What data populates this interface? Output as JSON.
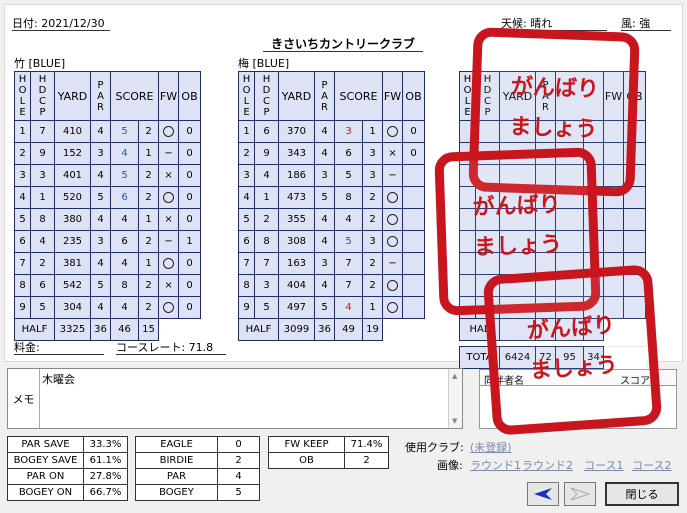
{
  "header": {
    "date": "日付: 2021/12/30",
    "weather": "天候: 晴れ",
    "wind": "風: 強",
    "course_title": "きさいちカントリークラブ"
  },
  "tables": [
    {
      "name": "竹 [BLUE]",
      "headers": [
        "HOLE",
        "HDCP",
        "YARD",
        "PAR",
        "SCORE",
        "FW",
        "OB"
      ],
      "rows": [
        {
          "hole": "1",
          "hdcp": "7",
          "yard": "410",
          "par": "4",
          "score": "5",
          "putt": "2",
          "fw": "○",
          "ob": "0",
          "sc": "blue"
        },
        {
          "hole": "2",
          "hdcp": "9",
          "yard": "152",
          "par": "3",
          "score": "4",
          "putt": "1",
          "fw": "−",
          "ob": "0",
          "sc": "blue"
        },
        {
          "hole": "3",
          "hdcp": "3",
          "yard": "401",
          "par": "4",
          "score": "5",
          "putt": "2",
          "fw": "×",
          "ob": "0",
          "sc": "blue"
        },
        {
          "hole": "4",
          "hdcp": "1",
          "yard": "520",
          "par": "5",
          "score": "6",
          "putt": "2",
          "fw": "○",
          "ob": "0",
          "sc": "blue"
        },
        {
          "hole": "5",
          "hdcp": "8",
          "yard": "380",
          "par": "4",
          "score": "4",
          "putt": "1",
          "fw": "×",
          "ob": "0",
          "sc": ""
        },
        {
          "hole": "6",
          "hdcp": "4",
          "yard": "235",
          "par": "3",
          "score": "6",
          "putt": "2",
          "fw": "−",
          "ob": "1",
          "sc": "bold"
        },
        {
          "hole": "7",
          "hdcp": "2",
          "yard": "381",
          "par": "4",
          "score": "4",
          "putt": "1",
          "fw": "○",
          "ob": "0",
          "sc": ""
        },
        {
          "hole": "8",
          "hdcp": "6",
          "yard": "542",
          "par": "5",
          "score": "8",
          "putt": "2",
          "fw": "×",
          "ob": "0",
          "sc": "bold"
        },
        {
          "hole": "9",
          "hdcp": "5",
          "yard": "304",
          "par": "4",
          "score": "4",
          "putt": "2",
          "fw": "○",
          "ob": "0",
          "sc": ""
        }
      ],
      "half": {
        "label": "HALF",
        "yard": "3325",
        "par": "36",
        "score": "46",
        "putt": "15"
      }
    },
    {
      "name": "梅 [BLUE]",
      "headers": [
        "HOLE",
        "HDCP",
        "YARD",
        "PAR",
        "SCORE",
        "FW",
        "OB"
      ],
      "rows": [
        {
          "hole": "1",
          "hdcp": "6",
          "yard": "370",
          "par": "4",
          "score": "3",
          "putt": "1",
          "fw": "○",
          "ob": "0",
          "sc": "red"
        },
        {
          "hole": "2",
          "hdcp": "9",
          "yard": "343",
          "par": "4",
          "score": "6",
          "putt": "3",
          "fw": "×",
          "ob": "0",
          "sc": "bold"
        },
        {
          "hole": "3",
          "hdcp": "4",
          "yard": "186",
          "par": "3",
          "score": "5",
          "putt": "3",
          "fw": "−",
          "ob": "",
          "sc": "bold"
        },
        {
          "hole": "4",
          "hdcp": "1",
          "yard": "473",
          "par": "5",
          "score": "8",
          "putt": "2",
          "fw": "○",
          "ob": "",
          "sc": "bold"
        },
        {
          "hole": "5",
          "hdcp": "2",
          "yard": "355",
          "par": "4",
          "score": "4",
          "putt": "2",
          "fw": "○",
          "ob": "",
          "sc": ""
        },
        {
          "hole": "6",
          "hdcp": "8",
          "yard": "308",
          "par": "4",
          "score": "5",
          "putt": "3",
          "fw": "○",
          "ob": "",
          "sc": "blue"
        },
        {
          "hole": "7",
          "hdcp": "7",
          "yard": "163",
          "par": "3",
          "score": "7",
          "putt": "2",
          "fw": "−",
          "ob": "",
          "sc": ""
        },
        {
          "hole": "8",
          "hdcp": "3",
          "yard": "404",
          "par": "4",
          "score": "7",
          "putt": "2",
          "fw": "○",
          "ob": "",
          "sc": "bold"
        },
        {
          "hole": "9",
          "hdcp": "5",
          "yard": "497",
          "par": "5",
          "score": "4",
          "putt": "1",
          "fw": "○",
          "ob": "",
          "sc": "red"
        }
      ],
      "half": {
        "label": "HALF",
        "yard": "3099",
        "par": "36",
        "score": "49",
        "putt": "19"
      }
    },
    {
      "name": "",
      "headers": [
        "HOLE",
        "HDCP",
        "YARD",
        "PAR",
        "",
        "FW",
        "OB"
      ],
      "rows": [
        {
          "hole": "",
          "hdcp": "",
          "yard": "",
          "par": "",
          "score": "",
          "putt": "",
          "fw": "",
          "ob": "",
          "sc": ""
        },
        {
          "hole": "",
          "hdcp": "",
          "yard": "",
          "par": "",
          "score": "",
          "putt": "",
          "fw": "",
          "ob": "",
          "sc": ""
        },
        {
          "hole": "",
          "hdcp": "",
          "yard": "",
          "par": "",
          "score": "",
          "putt": "",
          "fw": "",
          "ob": "",
          "sc": ""
        },
        {
          "hole": "",
          "hdcp": "",
          "yard": "",
          "par": "",
          "score": "",
          "putt": "",
          "fw": "",
          "ob": "",
          "sc": ""
        },
        {
          "hole": "",
          "hdcp": "",
          "yard": "",
          "par": "",
          "score": "",
          "putt": "",
          "fw": "",
          "ob": "",
          "sc": ""
        },
        {
          "hole": "",
          "hdcp": "",
          "yard": "",
          "par": "",
          "score": "",
          "putt": "",
          "fw": "",
          "ob": "",
          "sc": ""
        },
        {
          "hole": "",
          "hdcp": "",
          "yard": "",
          "par": "",
          "score": "",
          "putt": "",
          "fw": "",
          "ob": "",
          "sc": ""
        },
        {
          "hole": "",
          "hdcp": "",
          "yard": "",
          "par": "",
          "score": "",
          "putt": "",
          "fw": "",
          "ob": "",
          "sc": ""
        },
        {
          "hole": "",
          "hdcp": "",
          "yard": "",
          "par": "",
          "score": "",
          "putt": "",
          "fw": "",
          "ob": "",
          "sc": ""
        }
      ],
      "half": {
        "label": "HAL",
        "yard": "",
        "par": "",
        "score": "",
        "putt": ""
      },
      "total": {
        "label": "TOTA",
        "yard": "6424",
        "par": "72",
        "score": "95",
        "putt": "34"
      }
    }
  ],
  "fee_label": "料金:",
  "course_rate": "コースレート:  71.8",
  "memo": {
    "label": "メモ",
    "text": "木曜会"
  },
  "companion": {
    "col1": "同伴者名",
    "col2": "スコア"
  },
  "stats_left": [
    {
      "label": "PAR SAVE",
      "value": "33.3%"
    },
    {
      "label": "BOGEY SAVE",
      "value": "61.1%"
    },
    {
      "label": "PAR ON",
      "value": "27.8%"
    },
    {
      "label": "BOGEY ON",
      "value": "66.7%"
    }
  ],
  "stats_mid": [
    {
      "label": "EAGLE",
      "value": "0"
    },
    {
      "label": "BIRDIE",
      "value": "2"
    },
    {
      "label": "PAR",
      "value": "4"
    },
    {
      "label": "BOGEY",
      "value": "5"
    }
  ],
  "stats_right": [
    {
      "label": "FW KEEP",
      "value": "71.4%"
    },
    {
      "label": "OB",
      "value": "2"
    }
  ],
  "club_label": "使用クラブ:",
  "club_link": "(未登録)",
  "image_label": "画像:",
  "image_links": [
    "ラウンド1",
    "ラウンド2",
    "コース1",
    "コース2"
  ],
  "close_label": "閉じる",
  "stamp_lines": [
    "がんばり",
    "ましょう"
  ],
  "colors": {
    "stamp": "#c9161e",
    "table_bg": "#dde3f4",
    "grid": "#1f2d6b",
    "nav_arrow": "#1a2ec0"
  }
}
